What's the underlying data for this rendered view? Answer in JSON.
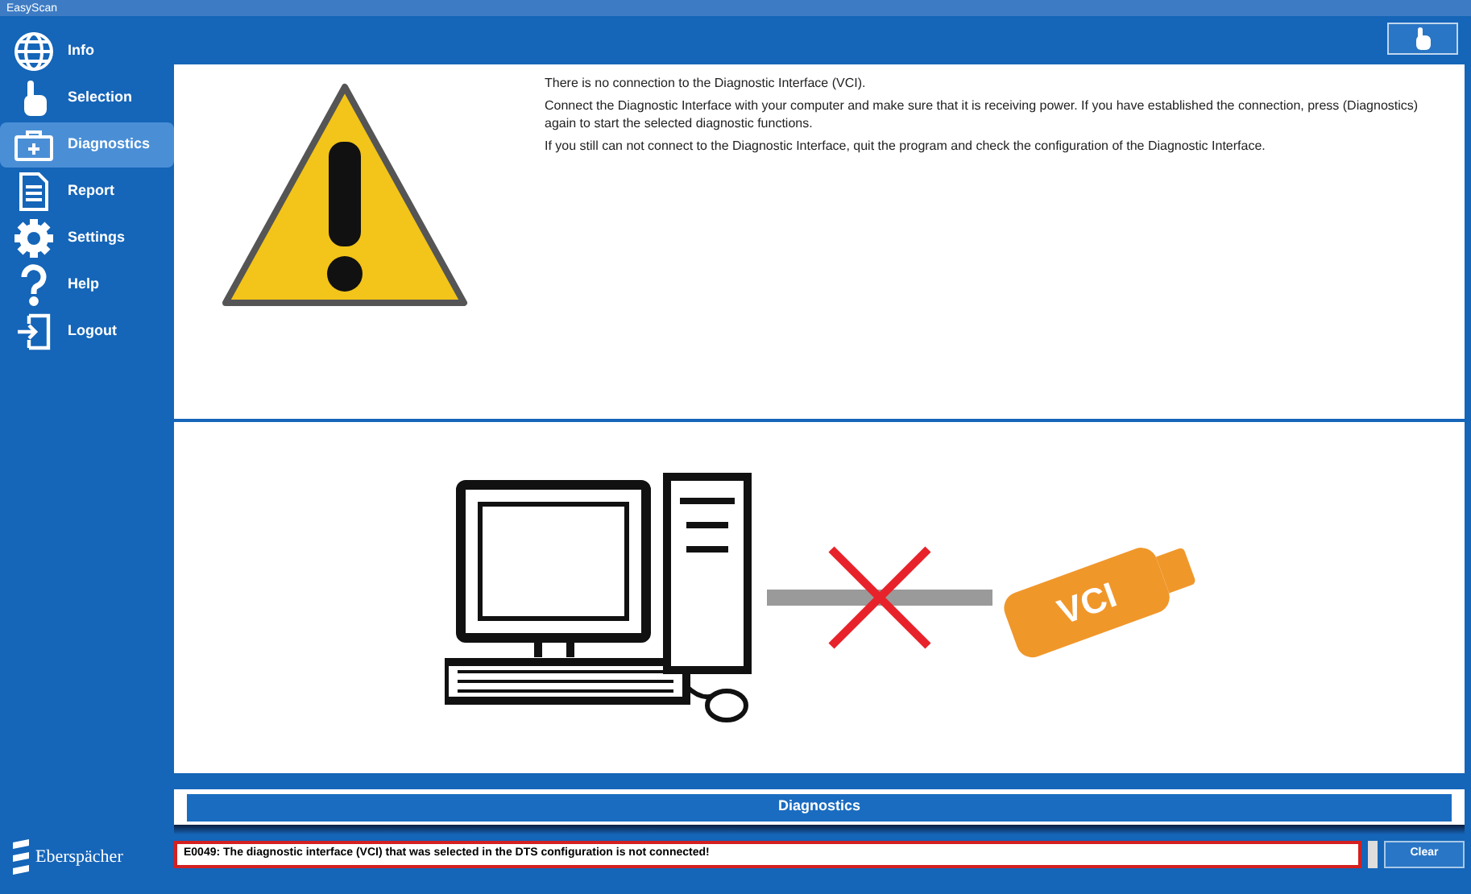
{
  "window": {
    "title": "EasyScan"
  },
  "sidebar": {
    "items": [
      {
        "label": "Info",
        "kind": "globe",
        "selected": false
      },
      {
        "label": "Selection",
        "kind": "hand",
        "selected": false
      },
      {
        "label": "Diagnostics",
        "kind": "case",
        "selected": true
      },
      {
        "label": "Report",
        "kind": "doc",
        "selected": false
      },
      {
        "label": "Settings",
        "kind": "gear",
        "selected": false
      },
      {
        "label": "Help",
        "kind": "help",
        "selected": false
      },
      {
        "label": "Logout",
        "kind": "logout",
        "selected": false
      }
    ],
    "logo": "Eberspächer"
  },
  "message": {
    "paragraphs": [
      "There is no connection to the Diagnostic Interface (VCI).",
      "Connect the Diagnostic Interface with your computer and make sure that it is receiving power. If you have established the connection, press (Diagnostics) again to start the selected diagnostic functions.",
      "If you still can not connect to the Diagnostic Interface, quit the program and check the configuration of the Diagnostic Interface."
    ]
  },
  "illustration": {
    "device_label": "VCI"
  },
  "section_bar": "Diagnostics",
  "status": {
    "error": "E0049: The diagnostic interface (VCI) that was selected in the DTS configuration is not connected!",
    "button": "Clear"
  }
}
